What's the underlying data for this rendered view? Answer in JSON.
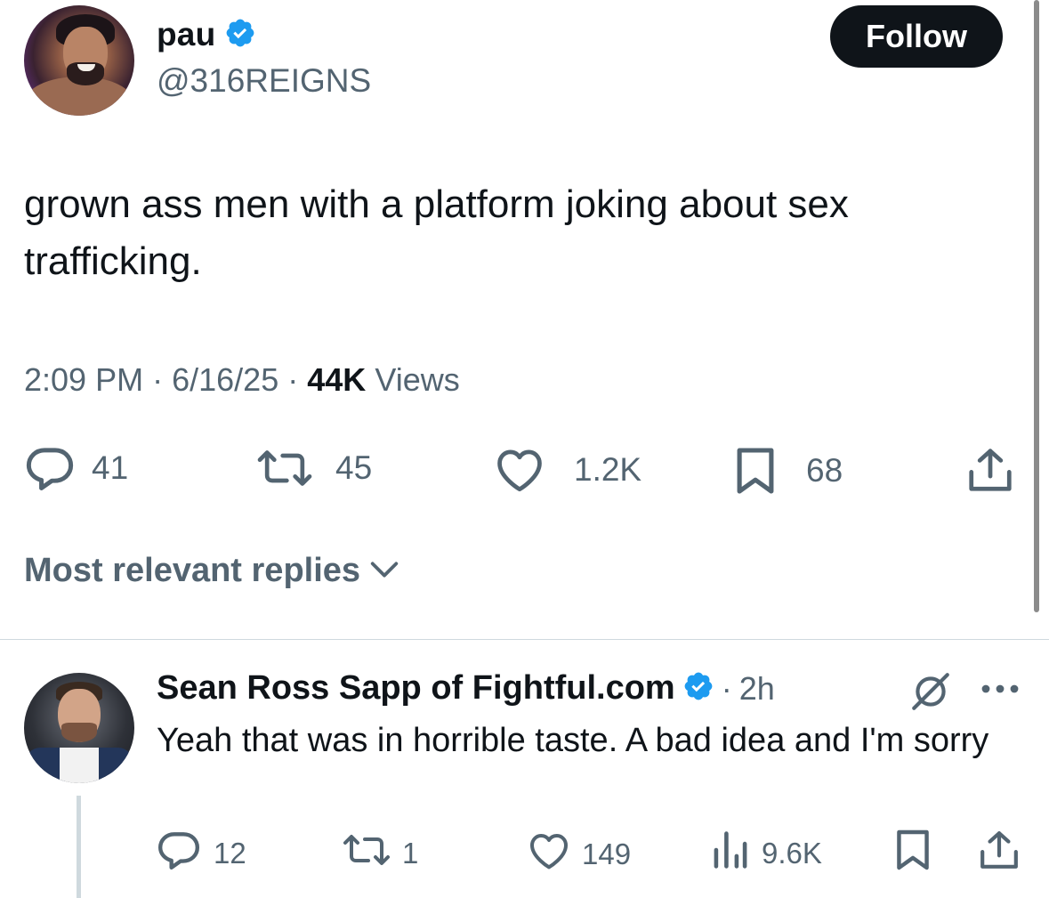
{
  "tweet": {
    "author": {
      "name": "pau",
      "handle": "@316REIGNS"
    },
    "follow_label": "Follow",
    "text": "grown ass men with a platform joking about sex trafficking.",
    "time": "2:09 PM",
    "sep1": "·",
    "date": "6/16/25",
    "sep2": "·",
    "views_count": "44K",
    "views_label": "Views",
    "actions": {
      "replies": "41",
      "reposts": "45",
      "likes": "1.2K",
      "bookmarks": "68"
    }
  },
  "replies_sort": {
    "label": "Most relevant replies"
  },
  "reply": {
    "author_name": "Sean Ross Sapp of Fightful.com",
    "sep": "·",
    "age": "2h",
    "text": "Yeah that was in horrible taste. A bad idea and I'm sorry",
    "actions": {
      "replies": "12",
      "reposts": "1",
      "likes": "149",
      "views": "9.6K"
    }
  },
  "colors": {
    "verified": "#1d9bf0",
    "text": "#0f1419",
    "secondary": "#536471",
    "divider": "#cfd9de",
    "follow_bg": "#0f1419"
  }
}
